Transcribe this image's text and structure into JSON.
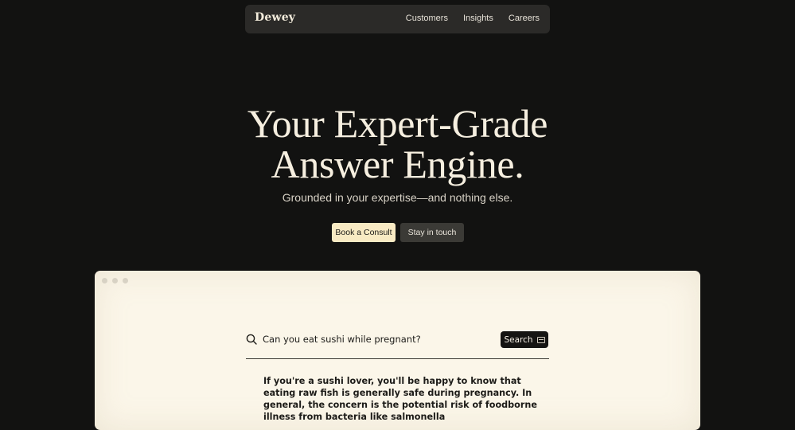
{
  "brand": "Dewey",
  "nav": [
    "Customers",
    "Insights",
    "Careers"
  ],
  "hero": {
    "title_line1": "Your Expert-Grade",
    "title_line2": "Answer Engine.",
    "subtitle": "Grounded in your expertise—and nothing else."
  },
  "buttons": {
    "primary": "Book a Consult",
    "secondary": "Stay in touch"
  },
  "demo": {
    "query": "Can you eat sushi while pregnant?",
    "search_label": "Search",
    "answer": "If you're a sushi lover, you'll be happy to know that eating raw fish is generally safe during pregnancy. In general, the concern is the potential risk of foodborne illness from bacteria like salmonella"
  }
}
